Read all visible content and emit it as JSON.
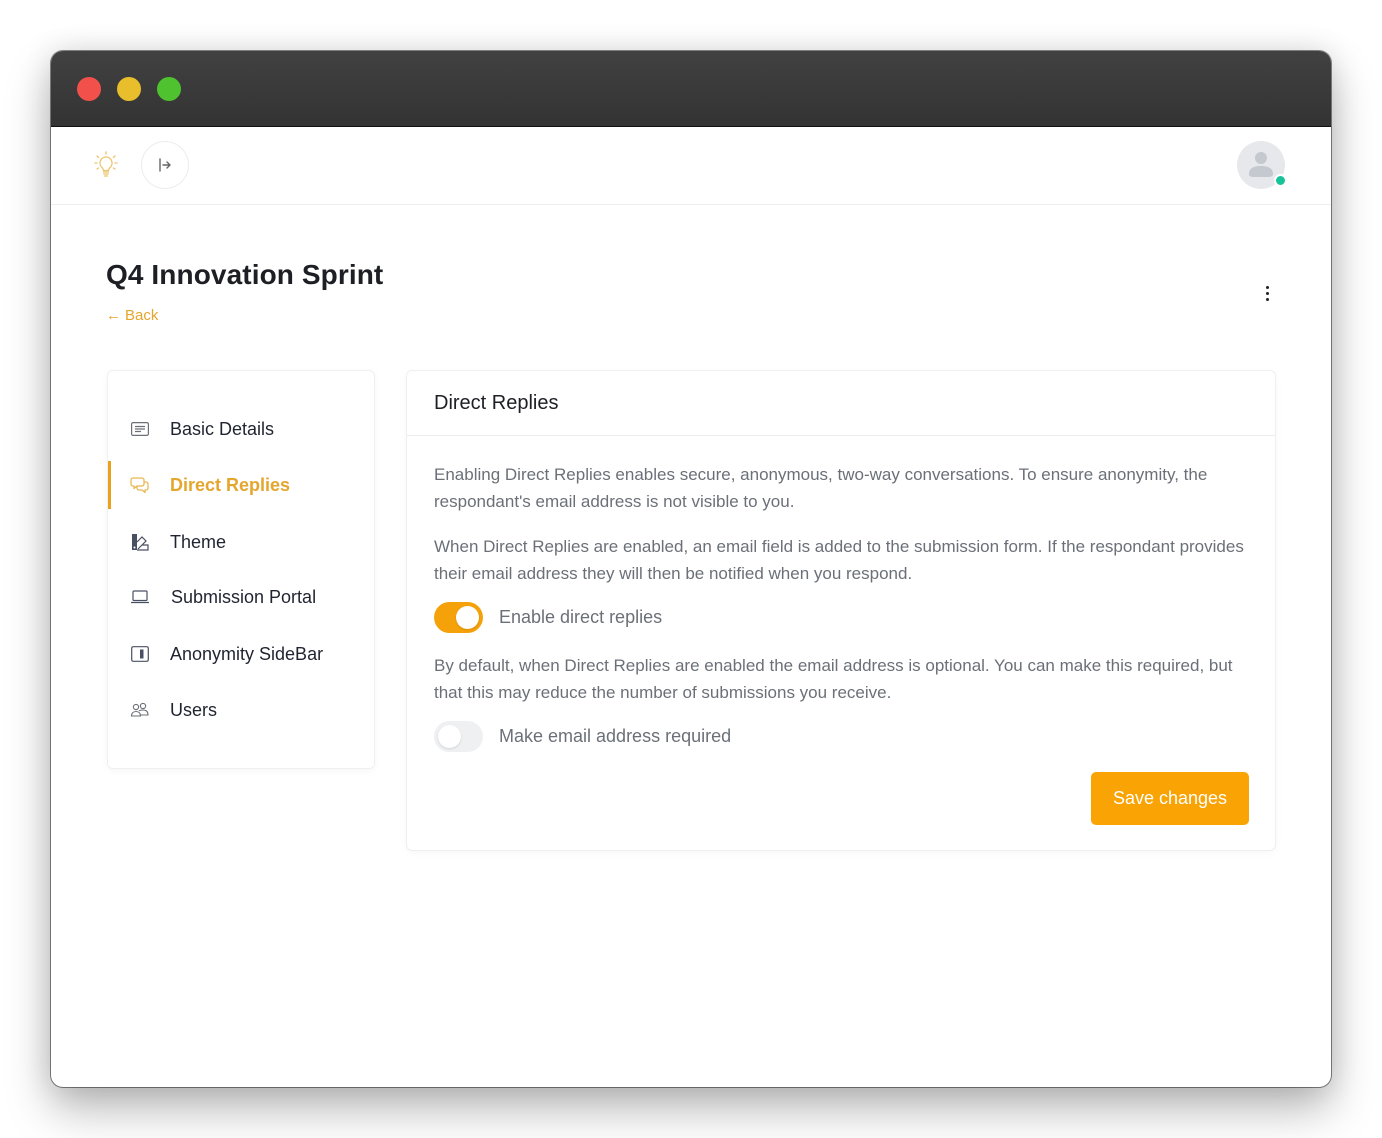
{
  "window": {
    "controls": [
      "close",
      "minimize",
      "maximize"
    ]
  },
  "topnav": {
    "logo_icon": "lightbulb-icon",
    "collapse_icon": "arrow-right-from-bar-icon",
    "avatar_icon": "user-avatar-icon",
    "avatar_status": "online",
    "status_color": "#17c49a"
  },
  "page": {
    "title": "Q4 Innovation Sprint",
    "back_label": "Back",
    "back_arrow": "←",
    "menu_icon": "kebab-menu-icon"
  },
  "sidebar": {
    "items": [
      {
        "label": "Basic Details",
        "icon": "document-lines-icon",
        "active": false
      },
      {
        "label": "Direct Replies",
        "icon": "chat-bubbles-icon",
        "active": true
      },
      {
        "label": "Theme",
        "icon": "color-swatch-icon",
        "active": false
      },
      {
        "label": "Submission Portal",
        "icon": "laptop-icon",
        "active": false
      },
      {
        "label": "Anonymity SideBar",
        "icon": "sidebar-panel-icon",
        "active": false
      },
      {
        "label": "Users",
        "icon": "users-icon",
        "active": false
      }
    ]
  },
  "panel": {
    "title": "Direct Replies",
    "paragraphs": [
      "Enabling Direct Replies enables secure, anonymous, two-way conversations. To ensure anonymity, the respondant's email address is not visible to you.",
      "When Direct Replies are enabled, an email field is added to the submission form. If the respondant provides their email address they will then be notified when you respond.",
      "By default, when Direct Replies are enabled the email address is optional. You can make this required, but that this may reduce the number of submissions you receive."
    ],
    "toggles": [
      {
        "label": "Enable direct replies",
        "checked": true
      },
      {
        "label": "Make email address required",
        "checked": false
      }
    ],
    "save_label": "Save changes"
  },
  "colors": {
    "accent": "#f9a304",
    "accent_text": "#e4a62d",
    "titlebar": "#3a3a3a"
  }
}
